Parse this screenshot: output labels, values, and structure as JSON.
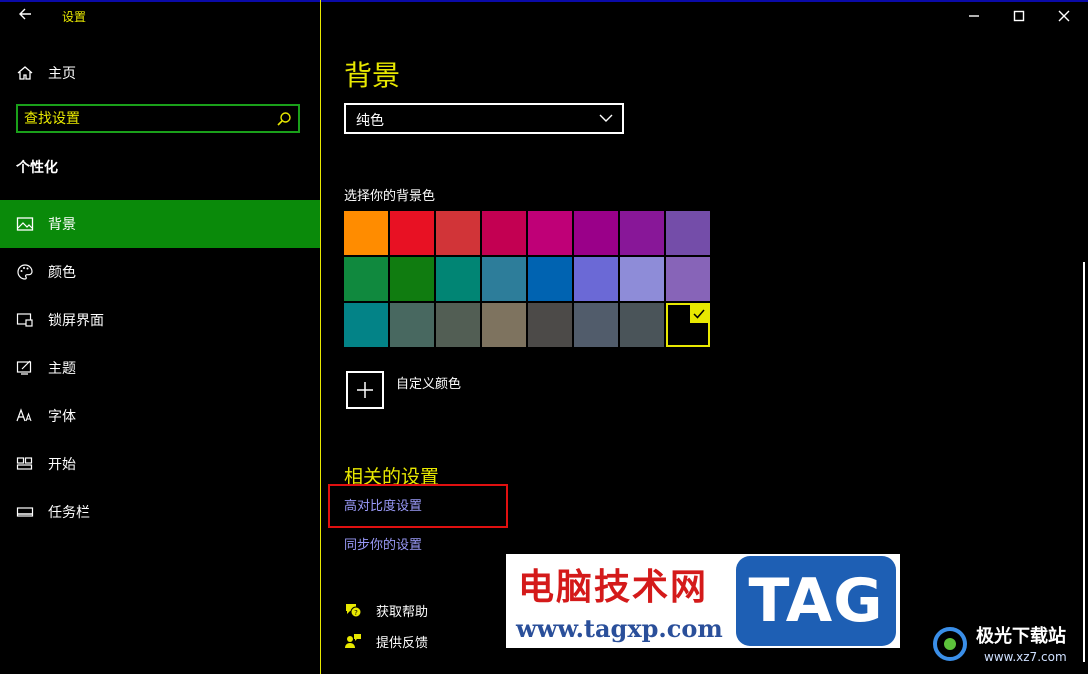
{
  "app_title": "设置",
  "sidebar": {
    "home_label": "主页",
    "search_placeholder": "查找设置",
    "section_title": "个性化",
    "items": [
      {
        "label": "背景",
        "icon": "image-icon",
        "active": true
      },
      {
        "label": "颜色",
        "icon": "palette-icon",
        "active": false
      },
      {
        "label": "锁屏界面",
        "icon": "lock-screen-icon",
        "active": false
      },
      {
        "label": "主题",
        "icon": "theme-icon",
        "active": false
      },
      {
        "label": "字体",
        "icon": "font-icon",
        "active": false
      },
      {
        "label": "开始",
        "icon": "start-icon",
        "active": false
      },
      {
        "label": "任务栏",
        "icon": "taskbar-icon",
        "active": false
      }
    ]
  },
  "main": {
    "title": "背景",
    "dropdown_value": "纯色",
    "color_label": "选择你的背景色",
    "colors": [
      "#ff8c00",
      "#e81123",
      "#d13438",
      "#c30052",
      "#bf0077",
      "#9a0089",
      "#881798",
      "#744da9",
      "#10893e",
      "#107c10",
      "#018574",
      "#2d7d9a",
      "#0063b1",
      "#6b69d6",
      "#8e8cd8",
      "#8764b8",
      "#038387",
      "#486860",
      "#525e54",
      "#7e735f",
      "#4c4a48",
      "#515c6b",
      "#4a5459",
      "#000000"
    ],
    "selected_color_index": 23,
    "custom_color_label": "自定义颜色",
    "related_title": "相关的设置",
    "links": [
      "高对比度设置",
      "同步你的设置"
    ],
    "help_label": "获取帮助",
    "feedback_label": "提供反馈"
  },
  "watermark": {
    "cn_text": "电脑技术网",
    "url": "www.tagxp.com",
    "tag": "TAG",
    "site2_cn": "极光下载站",
    "site2_url": "www.xz7.com"
  },
  "theme": {
    "accent_yellow": "#e8e800",
    "active_green": "#0a8a0a",
    "link_color": "#9a9af8",
    "highlight_red": "#e01010"
  }
}
